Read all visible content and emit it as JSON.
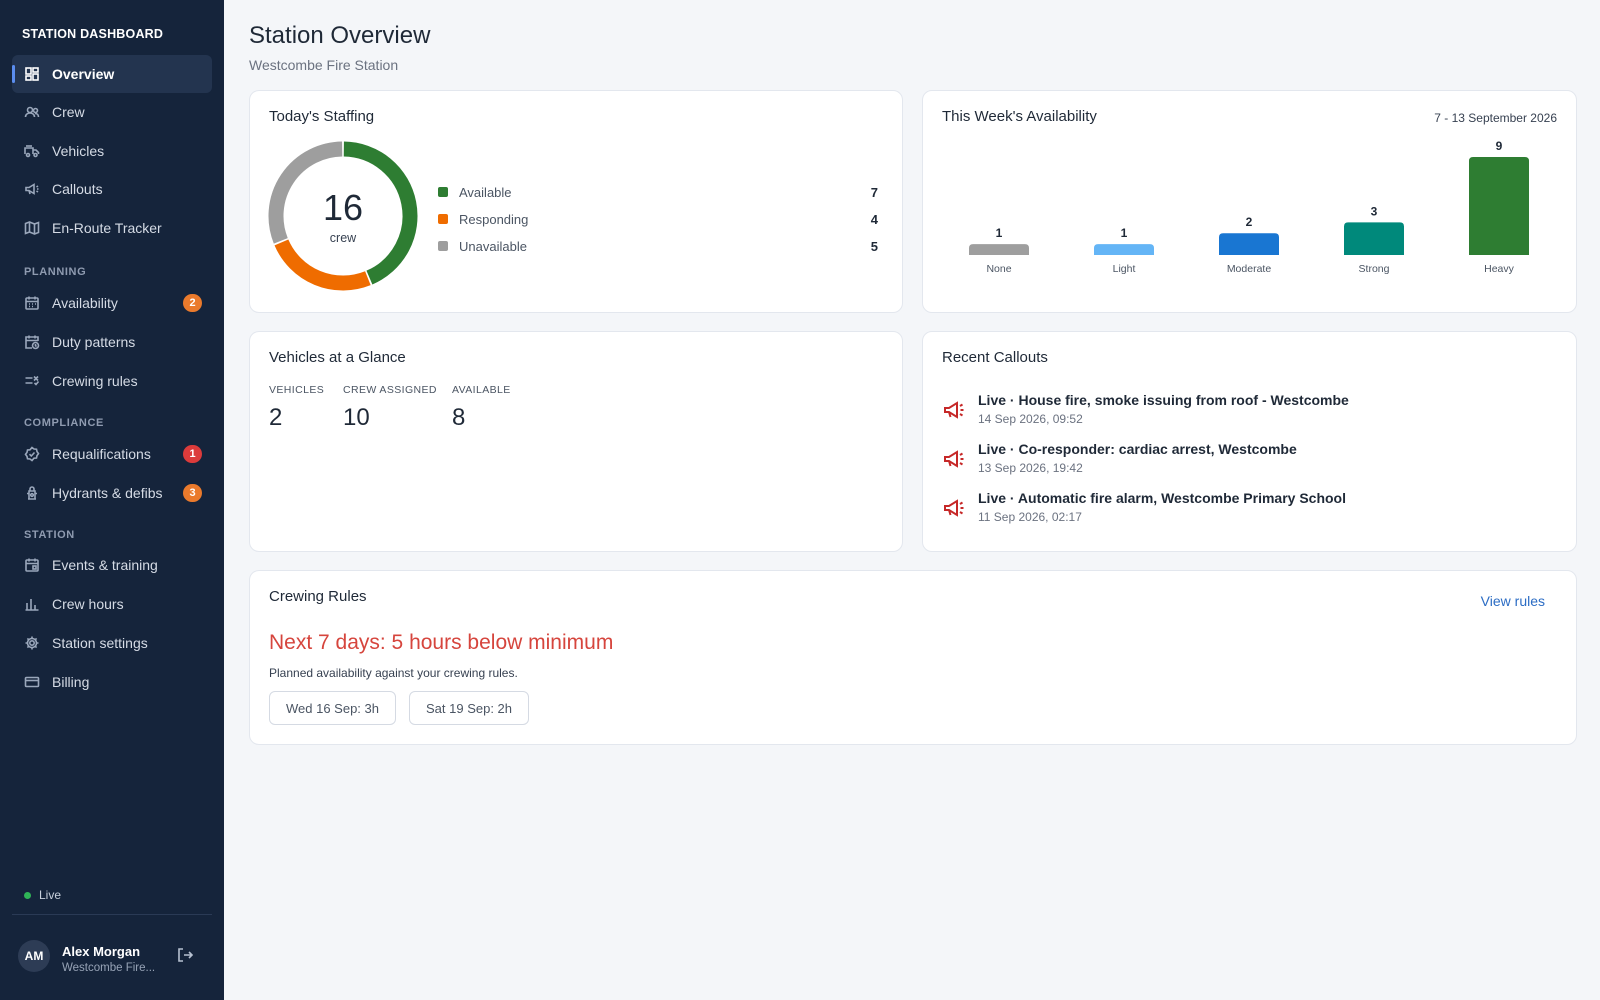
{
  "sidebar": {
    "brand": "STATION DASHBOARD",
    "main_items": [
      {
        "label": "Overview",
        "icon": "dashboard-icon"
      },
      {
        "label": "Crew",
        "icon": "people-icon"
      },
      {
        "label": "Vehicles",
        "icon": "fire-truck-icon"
      },
      {
        "label": "Callouts",
        "icon": "megaphone-icon"
      },
      {
        "label": "En-Route Tracker",
        "icon": "map-icon"
      }
    ],
    "sections": {
      "planning": "PLANNING",
      "compliance": "COMPLIANCE",
      "station": "STATION"
    },
    "planning_items": [
      {
        "label": "Availability",
        "icon": "calendar-icon",
        "badge": "2"
      },
      {
        "label": "Duty patterns",
        "icon": "calendar-clock-icon"
      },
      {
        "label": "Crewing rules",
        "icon": "rule-icon"
      }
    ],
    "compliance_items": [
      {
        "label": "Requalifications",
        "icon": "verified-icon",
        "badge": "1"
      },
      {
        "label": "Hydrants & defibs",
        "icon": "hydrant-icon",
        "badge": "3"
      }
    ],
    "station_items": [
      {
        "label": "Events & training",
        "icon": "event-icon"
      },
      {
        "label": "Crew hours",
        "icon": "bar-chart-icon"
      },
      {
        "label": "Station settings",
        "icon": "gear-icon"
      },
      {
        "label": "Billing",
        "icon": "credit-card-icon"
      }
    ],
    "status": "Live",
    "user": {
      "initials": "AM",
      "name": "Alex Morgan",
      "station": "Westcombe Fire..."
    }
  },
  "colors": {
    "sidebar_bg": "#15243b",
    "badge_orange": "#ea7a2c",
    "badge_red": "#dc3b3b",
    "available": "#2e7d32",
    "responding": "#ef6c00",
    "unavailable": "#9e9e9e",
    "alert_red": "#d6453d",
    "link_blue": "#2b6cc4"
  },
  "header": {
    "title": "Station Overview",
    "subtitle": "Westcombe Fire Station"
  },
  "staffing": {
    "title": "Today's Staffing",
    "total": "16",
    "unit": "crew",
    "legend": [
      {
        "label": "Available",
        "value": "7",
        "color": "#2e7d32"
      },
      {
        "label": "Responding",
        "value": "4",
        "color": "#ef6c00"
      },
      {
        "label": "Unavailable",
        "value": "5",
        "color": "#9e9e9e"
      }
    ]
  },
  "availability": {
    "title": "This Week's Availability",
    "range": "7 - 13 September 2026"
  },
  "chart_data": {
    "type": "bar",
    "categories": [
      "None",
      "Light",
      "Moderate",
      "Strong",
      "Heavy"
    ],
    "values": [
      1,
      1,
      2,
      3,
      9
    ],
    "colors": [
      "#9e9e9e",
      "#64b5f6",
      "#1976d2",
      "#00897b",
      "#2e7d32"
    ],
    "title": "This Week's Availability",
    "xlabel": "",
    "ylabel": ""
  },
  "vehicles": {
    "title": "Vehicles at a Glance",
    "stats": [
      {
        "label": "VEHICLES",
        "value": "2"
      },
      {
        "label": "CREW ASSIGNED",
        "value": "10"
      },
      {
        "label": "AVAILABLE",
        "value": "8"
      }
    ]
  },
  "callouts": {
    "title": "Recent Callouts",
    "items": [
      {
        "title": "Live · House fire, smoke issuing from roof - Westcombe",
        "time": "14 Sep 2026, 09:52"
      },
      {
        "title": "Live · Co-responder: cardiac arrest, Westcombe",
        "time": "13 Sep 2026, 19:42"
      },
      {
        "title": "Live · Automatic fire alarm, Westcombe Primary School",
        "time": "11 Sep 2026, 02:17"
      }
    ]
  },
  "crewing_rules": {
    "title": "Crewing Rules",
    "link": "View rules",
    "headline": "Next 7 days: 5 hours below minimum",
    "subtext": "Planned availability against your crewing rules.",
    "chips": [
      "Wed 16 Sep: 3h",
      "Sat 19 Sep: 2h"
    ]
  }
}
